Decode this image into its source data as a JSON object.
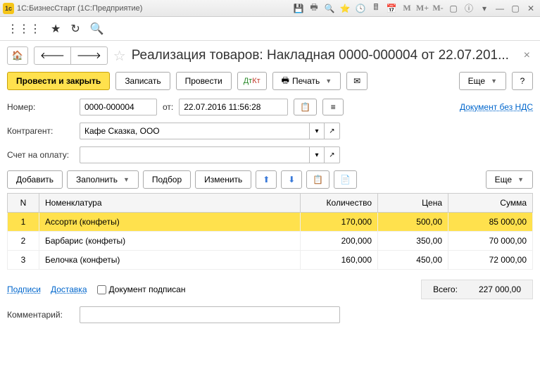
{
  "window": {
    "title": "1C:БизнесСтарт  (1C:Предприятие)",
    "m_label": "M",
    "mplus_label": "M+",
    "mminus_label": "M-"
  },
  "doc": {
    "title": "Реализация товаров: Накладная 0000-000004 от 22.07.201..."
  },
  "actions": {
    "post_close": "Провести и закрыть",
    "save": "Записать",
    "post": "Провести",
    "print": "Печать",
    "more": "Еще",
    "help": "?"
  },
  "form": {
    "number_label": "Номер:",
    "number_value": "0000-000004",
    "from_label": "от:",
    "date_value": "22.07.2016 11:56:28",
    "no_vat_link": "Документ без НДС",
    "counterparty_label": "Контрагент:",
    "counterparty_value": "Кафе Сказка, ООО",
    "invoice_label": "Счет на оплату:"
  },
  "table_actions": {
    "add": "Добавить",
    "fill": "Заполнить",
    "pick": "Подбор",
    "edit": "Изменить",
    "more": "Еще"
  },
  "table": {
    "headers": {
      "n": "N",
      "name": "Номенклатура",
      "qty": "Количество",
      "price": "Цена",
      "sum": "Сумма"
    },
    "rows": [
      {
        "n": "1",
        "name": "Ассорти (конфеты)",
        "qty": "170,000",
        "price": "500,00",
        "sum": "85 000,00",
        "selected": true
      },
      {
        "n": "2",
        "name": "Барбарис (конфеты)",
        "qty": "200,000",
        "price": "350,00",
        "sum": "70 000,00",
        "selected": false
      },
      {
        "n": "3",
        "name": "Белочка (конфеты)",
        "qty": "160,000",
        "price": "450,00",
        "sum": "72 000,00",
        "selected": false
      }
    ]
  },
  "footer": {
    "signatures": "Подписи",
    "delivery": "Доставка",
    "signed": "Документ подписан",
    "total_label": "Всего:",
    "total_value": "227 000,00",
    "comment_label": "Комментарий:"
  }
}
